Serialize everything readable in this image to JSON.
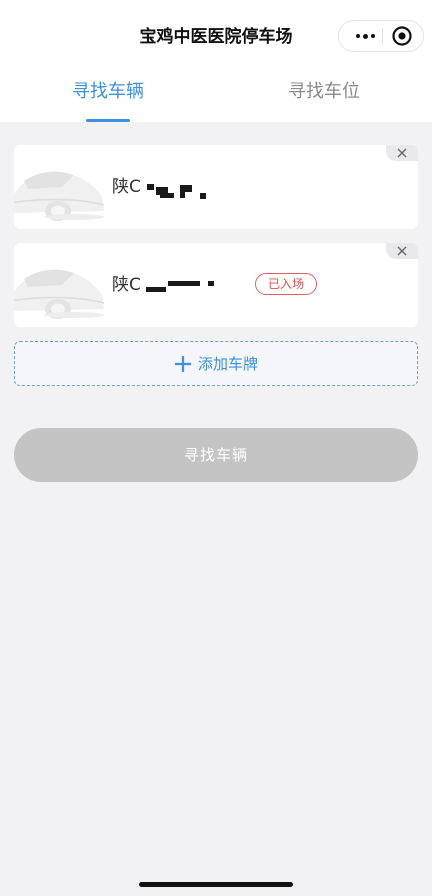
{
  "header": {
    "title": "宝鸡中医医院停车场"
  },
  "tabs": [
    {
      "label": "寻找车辆",
      "active": true
    },
    {
      "label": "寻找车位",
      "active": false
    }
  ],
  "vehicles": [
    {
      "plate_prefix": "陕C",
      "status": ""
    },
    {
      "plate_prefix": "陕C",
      "status": "已入场"
    }
  ],
  "add_plate_label": "添加车牌",
  "find_button_label": "寻找车辆",
  "colors": {
    "accent": "#3d8fe0",
    "status_red": "#e05050",
    "disabled_button": "#c4c4c4",
    "page_background": "#f2f1f4"
  },
  "icons": {
    "more": "more-dots-icon",
    "target": "target-icon",
    "close": "close-icon",
    "add": "plus-icon",
    "car": "car-icon"
  }
}
